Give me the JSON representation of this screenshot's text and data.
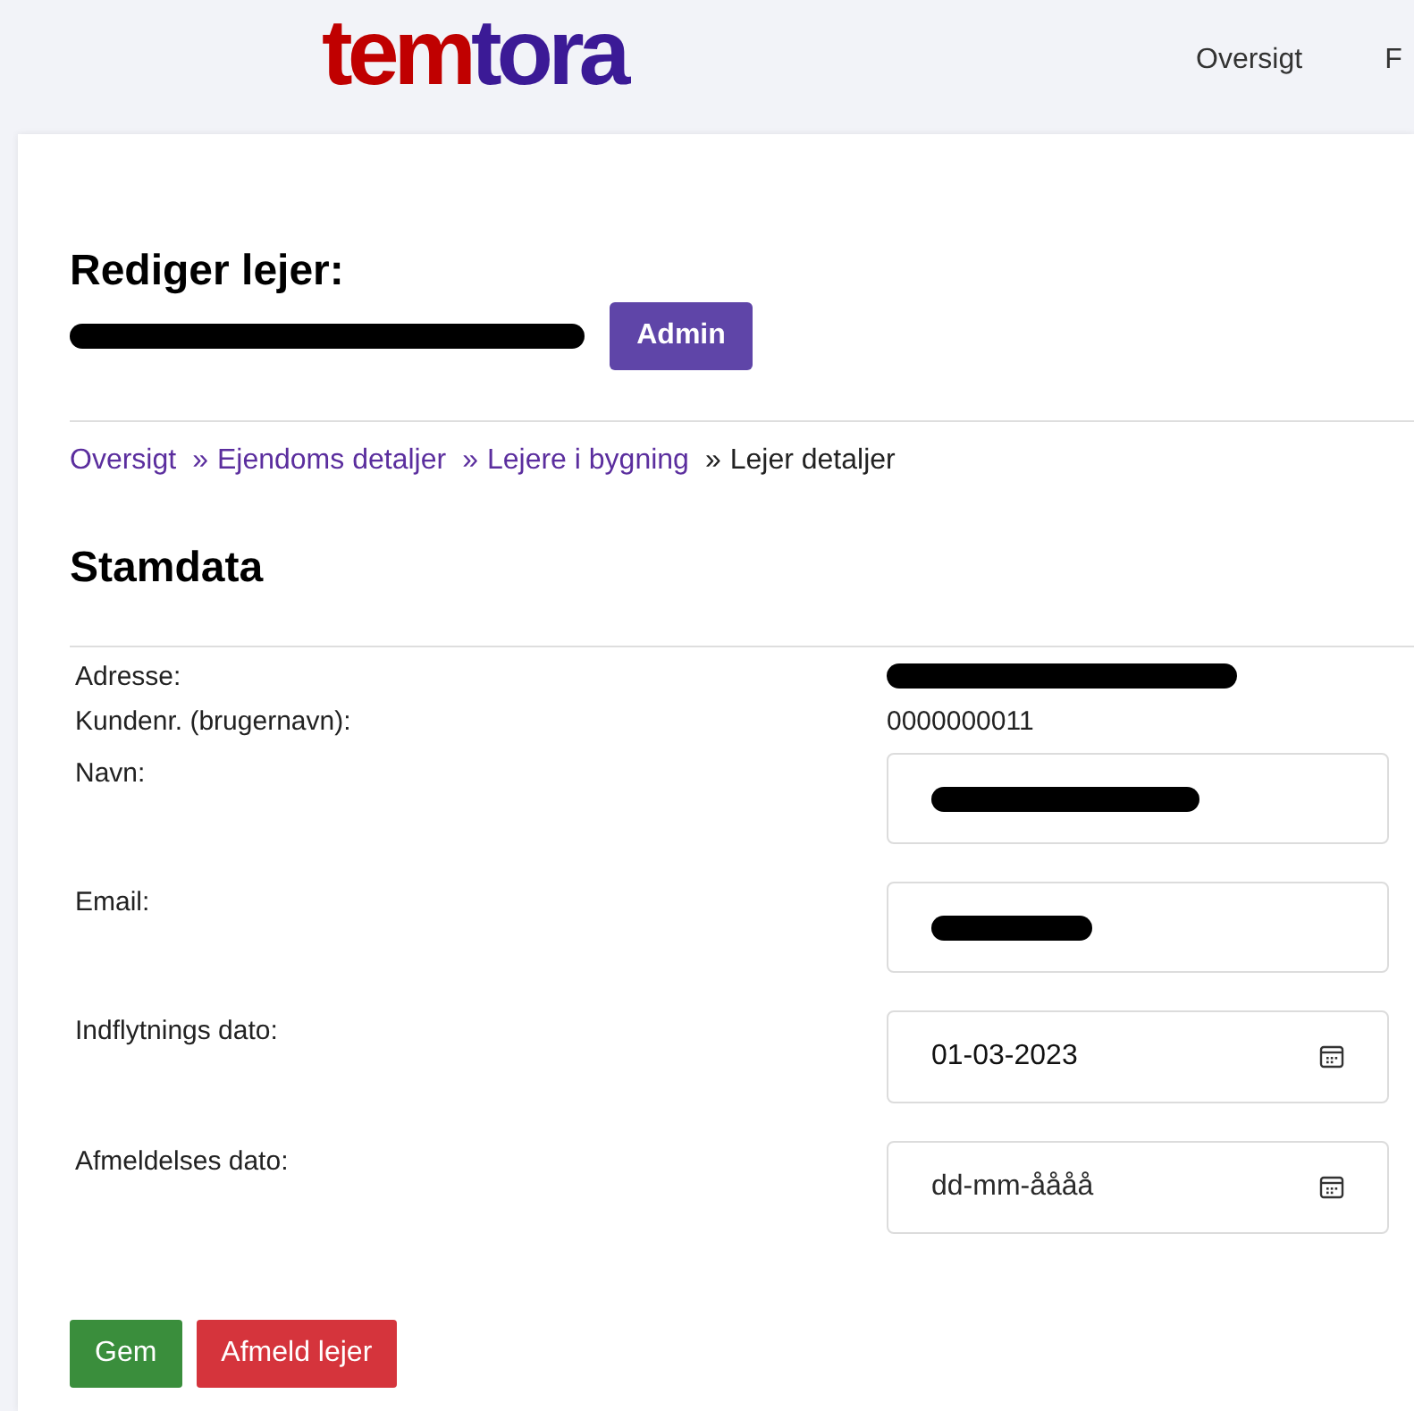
{
  "header": {
    "logo": [
      {
        "text": "tem",
        "color": "#c00000"
      },
      {
        "text": "tora",
        "color": "#3b1a96"
      }
    ],
    "nav": [
      {
        "label": "Oversigt"
      },
      {
        "label": "F"
      }
    ]
  },
  "title": "Rediger lejer:",
  "subtitle": {
    "redacted": true
  },
  "admin_button": "Admin",
  "breadcrumb": [
    {
      "label": "Oversigt",
      "link": true
    },
    {
      "label": "Ejendoms detaljer",
      "link": true,
      "sep": "»"
    },
    {
      "label": "Lejere i bygning",
      "link": true,
      "sep": "»"
    },
    {
      "label": "Lejer detaljer",
      "link": false,
      "sep": "»"
    }
  ],
  "section_title": "Stamdata",
  "fields": [
    {
      "label": "Adresse:",
      "kind": "text",
      "redacted": true
    },
    {
      "label": "Kundenr. (brugernavn):",
      "kind": "text",
      "value": "0000000011"
    },
    {
      "label": "Navn:",
      "kind": "input",
      "redacted": true
    },
    {
      "label": "Email:",
      "kind": "input",
      "redacted": true
    },
    {
      "label": "Indflytnings dato:",
      "kind": "date",
      "value": "01-03-2023"
    },
    {
      "label": "Afmeldelses dato:",
      "kind": "date",
      "placeholder": "dd-mm-åååå"
    }
  ],
  "buttons": [
    {
      "label": "Gem",
      "kind": "primary"
    },
    {
      "label": "Afmeld lejer",
      "kind": "danger"
    }
  ]
}
